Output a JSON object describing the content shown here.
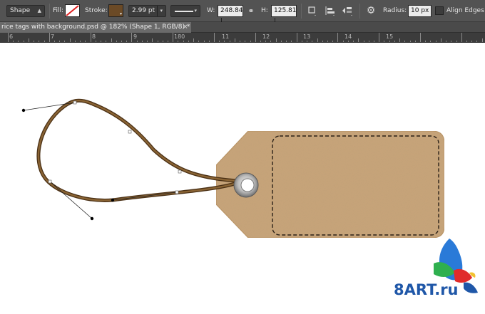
{
  "options_bar": {
    "mode_label": "Shape",
    "fill_label": "Fill:",
    "stroke_label": "Stroke:",
    "stroke_width": "2.99 pt",
    "width_label": "W:",
    "width_value": "248.84 |",
    "height_label": "H:",
    "height_value": "125.81 |",
    "radius_label": "Radius:",
    "radius_value": "10 px",
    "align_edges_label": "Align Edges",
    "stroke_color": "#6b4a26",
    "icons": [
      "dropdown-arrow-icon",
      "no-fill-swatch-icon",
      "link-icon",
      "path-operations-icon",
      "path-alignment-icon",
      "path-arrangement-icon",
      "gear-icon"
    ]
  },
  "document_tab": {
    "title": "rice tags with background.psd @ 182% (Shape 1, RGB/8) *",
    "close_glyph": "×"
  },
  "ruler": {
    "labels": [
      "6",
      "7",
      "8",
      "9",
      "180",
      "11",
      "12",
      "13",
      "14",
      "15"
    ]
  },
  "canvas": {
    "tag_color": "#c9a57a",
    "string_color": "#6b4a26",
    "watermark": "8ART.ru"
  }
}
